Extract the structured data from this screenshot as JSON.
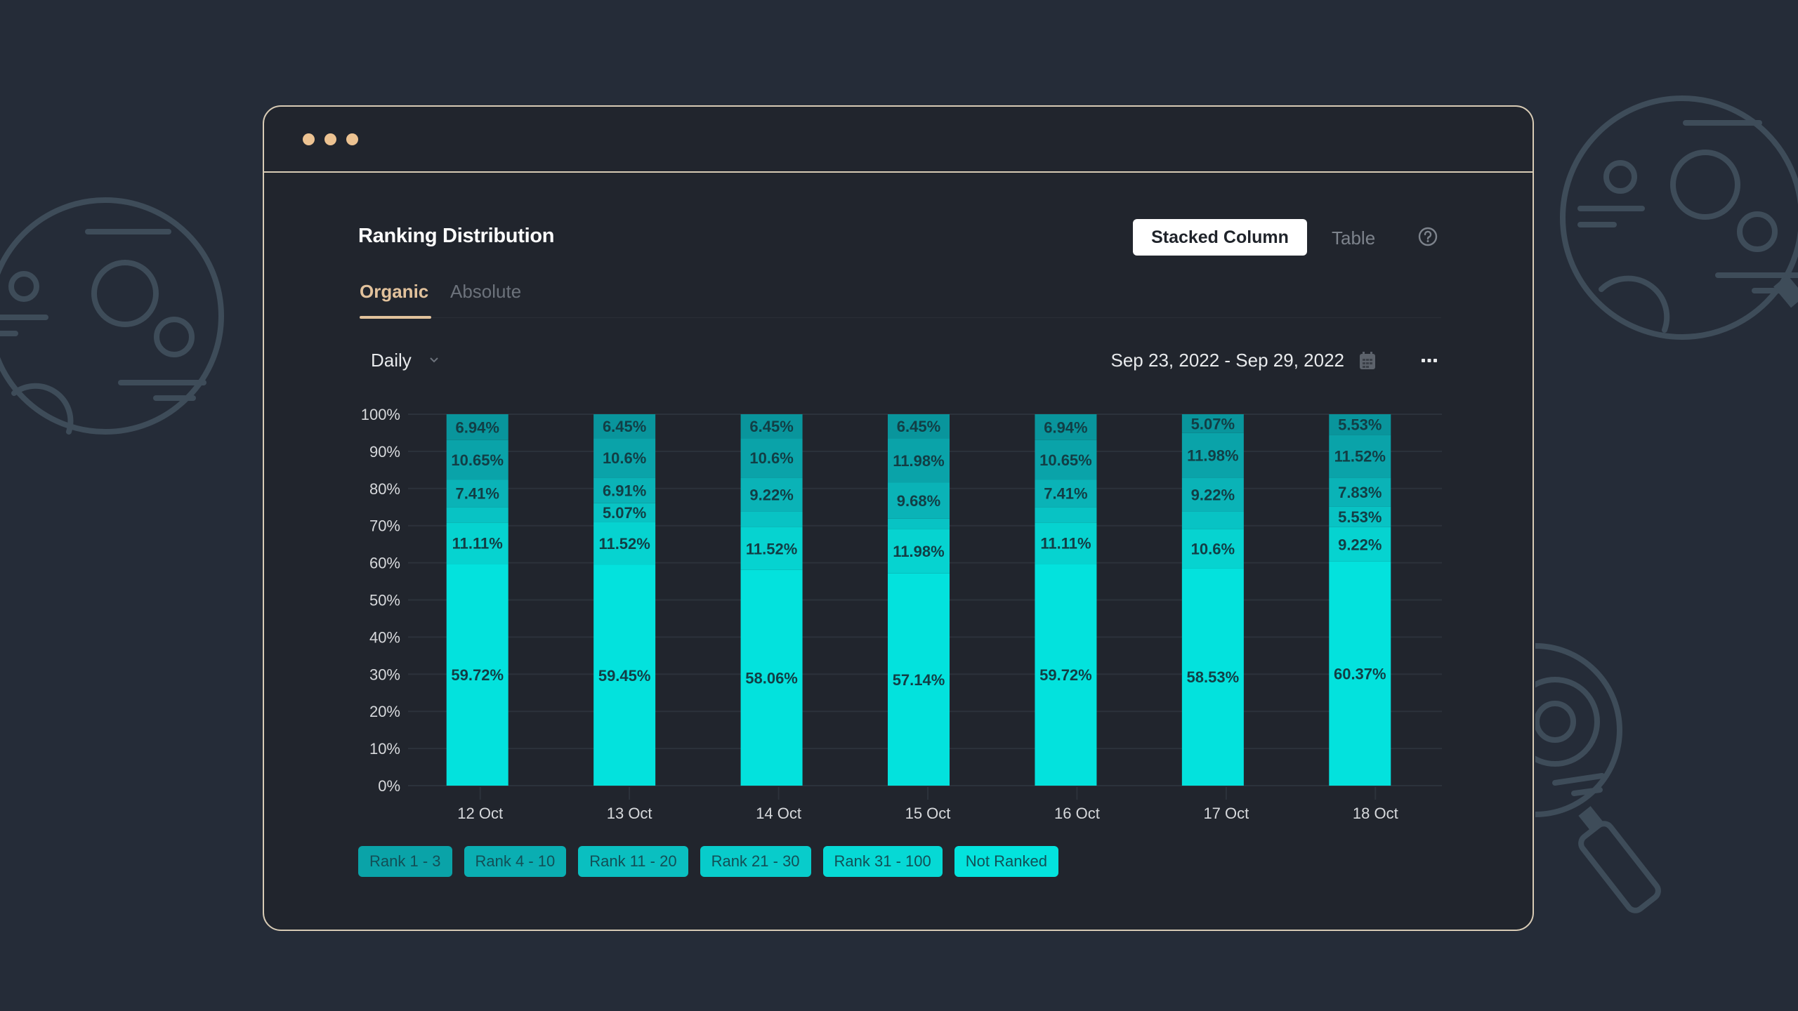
{
  "window": {
    "dots": [
      "dot-1",
      "dot-2",
      "dot-3"
    ]
  },
  "header": {
    "title": "Ranking Distribution",
    "view_options": {
      "active": "Stacked Column",
      "other": "Table"
    },
    "help_icon": "question-circle-icon"
  },
  "tabs": [
    {
      "label": "Organic",
      "active": true
    },
    {
      "label": "Absolute",
      "active": false
    }
  ],
  "controls": {
    "period": "Daily",
    "period_icon": "chevron-down-icon",
    "date_range": "Sep 23, 2022 - Sep 29, 2022",
    "calendar_icon": "calendar-icon",
    "more_icon": "ellipsis-icon"
  },
  "colors": {
    "accent": "#e2c29c",
    "series": [
      "#0a9aa0",
      "#0aa7ac",
      "#0ab8ba",
      "#08c6c6",
      "#06d5d2",
      "#03e2dd"
    ]
  },
  "chart_data": {
    "type": "bar",
    "stacked": true,
    "title": "",
    "xlabel": "",
    "ylabel": "",
    "ylim": [
      0,
      100
    ],
    "yticks": [
      "0%",
      "10%",
      "20%",
      "30%",
      "40%",
      "50%",
      "60%",
      "70%",
      "80%",
      "90%",
      "100%"
    ],
    "grid": true,
    "legend_position": "bottom-left",
    "categories": [
      "12 Oct",
      "13 Oct",
      "14 Oct",
      "15 Oct",
      "16 Oct",
      "17 Oct",
      "18 Oct"
    ],
    "series": [
      {
        "name": "Not Ranked",
        "values": [
          59.72,
          59.45,
          58.06,
          57.14,
          59.72,
          58.53,
          60.37
        ]
      },
      {
        "name": "Rank 31 - 100",
        "values": [
          11.11,
          11.52,
          11.52,
          11.98,
          11.11,
          10.6,
          9.22
        ]
      },
      {
        "name": "Rank 21 - 30",
        "values": [
          4.17,
          5.07,
          4.15,
          2.77,
          4.17,
          4.6,
          5.53
        ]
      },
      {
        "name": "Rank 11 - 20",
        "values": [
          7.41,
          6.91,
          9.22,
          9.68,
          7.41,
          9.22,
          7.83
        ]
      },
      {
        "name": "Rank 4 - 10",
        "values": [
          10.65,
          10.6,
          10.6,
          11.98,
          10.65,
          11.98,
          11.52
        ]
      },
      {
        "name": "Rank 1 - 3",
        "values": [
          6.94,
          6.45,
          6.45,
          6.45,
          6.94,
          5.07,
          5.53
        ]
      }
    ],
    "labels": [
      [
        "59.72%",
        "11.11%",
        "",
        "7.41%",
        "10.65%",
        "6.94%"
      ],
      [
        "59.45%",
        "11.52%",
        "5.07%",
        "6.91%",
        "10.6%",
        "6.45%"
      ],
      [
        "58.06%",
        "11.52%",
        "",
        "9.22%",
        "10.6%",
        "6.45%"
      ],
      [
        "57.14%",
        "11.98%",
        "",
        "9.68%",
        "11.98%",
        "6.45%"
      ],
      [
        "59.72%",
        "11.11%",
        "",
        "7.41%",
        "10.65%",
        "6.94%"
      ],
      [
        "58.53%",
        "10.6%",
        "",
        "9.22%",
        "11.98%",
        "5.07%"
      ],
      [
        "60.37%",
        "9.22%",
        "5.53%",
        "7.83%",
        "11.52%",
        "5.53%"
      ]
    ]
  },
  "legend": [
    {
      "label": "Rank 1 - 3",
      "color": "#0aa3a8"
    },
    {
      "label": "Rank 4 - 10",
      "color": "#0aaeb2"
    },
    {
      "label": "Rank 11 - 20",
      "color": "#0abfc0"
    },
    {
      "label": "Rank 21 - 30",
      "color": "#08cccb"
    },
    {
      "label": "Rank 31 - 100",
      "color": "#06d9d5"
    },
    {
      "label": "Not Ranked",
      "color": "#03e3dd"
    }
  ]
}
